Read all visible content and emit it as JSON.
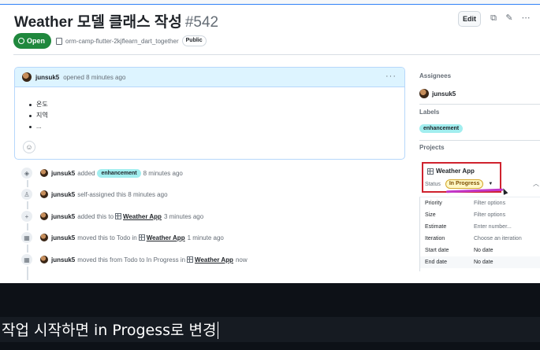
{
  "issue": {
    "title": "Weather 모델 클래스 작성",
    "number": "#542",
    "edit_label": "Edit",
    "state": "Open",
    "repo": "orm-camp-flutter-2kjflearn_dart_together",
    "visibility": "Public"
  },
  "comment": {
    "author": "junsuk5",
    "meta": "opened 8 minutes ago",
    "bullets": [
      "온도",
      "지역",
      "..."
    ]
  },
  "timeline": [
    {
      "icon": "tag-icon",
      "user": "junsuk5",
      "pre": "added",
      "label": "enhancement",
      "post": "8 minutes ago"
    },
    {
      "icon": "person-icon",
      "user": "junsuk5",
      "pre": "self-assigned this 8 minutes ago"
    },
    {
      "icon": "plus-icon",
      "user": "junsuk5",
      "pre": "added this to",
      "link": "Weather App",
      "post": "3 minutes ago"
    },
    {
      "icon": "table-icon",
      "user": "junsuk5",
      "pre": "moved this to Todo in",
      "link": "Weather App",
      "post": "1 minute ago"
    },
    {
      "icon": "table-icon",
      "user": "junsuk5",
      "pre": "moved this from Todo to In Progress in",
      "link": "Weather App",
      "post": "now"
    }
  ],
  "sidebar": {
    "assignees_heading": "Assignees",
    "assignee": "junsuk5",
    "labels_heading": "Labels",
    "label": "enhancement",
    "projects_heading": "Projects",
    "project_name": "Weather App",
    "status_label": "Status",
    "status_value": "In Progress",
    "fields": [
      {
        "name": "Priority",
        "value": "Filter options"
      },
      {
        "name": "Size",
        "value": "Filter options"
      },
      {
        "name": "Estimate",
        "value": "Enter number..."
      },
      {
        "name": "Iteration",
        "value": "Choose an iteration"
      },
      {
        "name": "Start date",
        "value": "No date"
      },
      {
        "name": "End date",
        "value": "No date"
      }
    ]
  },
  "caption": "작업 시작하면 in Progess로 변경",
  "colors": {
    "open_green": "#1f883d",
    "label_cyan": "#a2eeef",
    "highlight_red": "#cf222e",
    "status_yellow": "#fff8c5",
    "mark_purple": "#c237c9"
  }
}
